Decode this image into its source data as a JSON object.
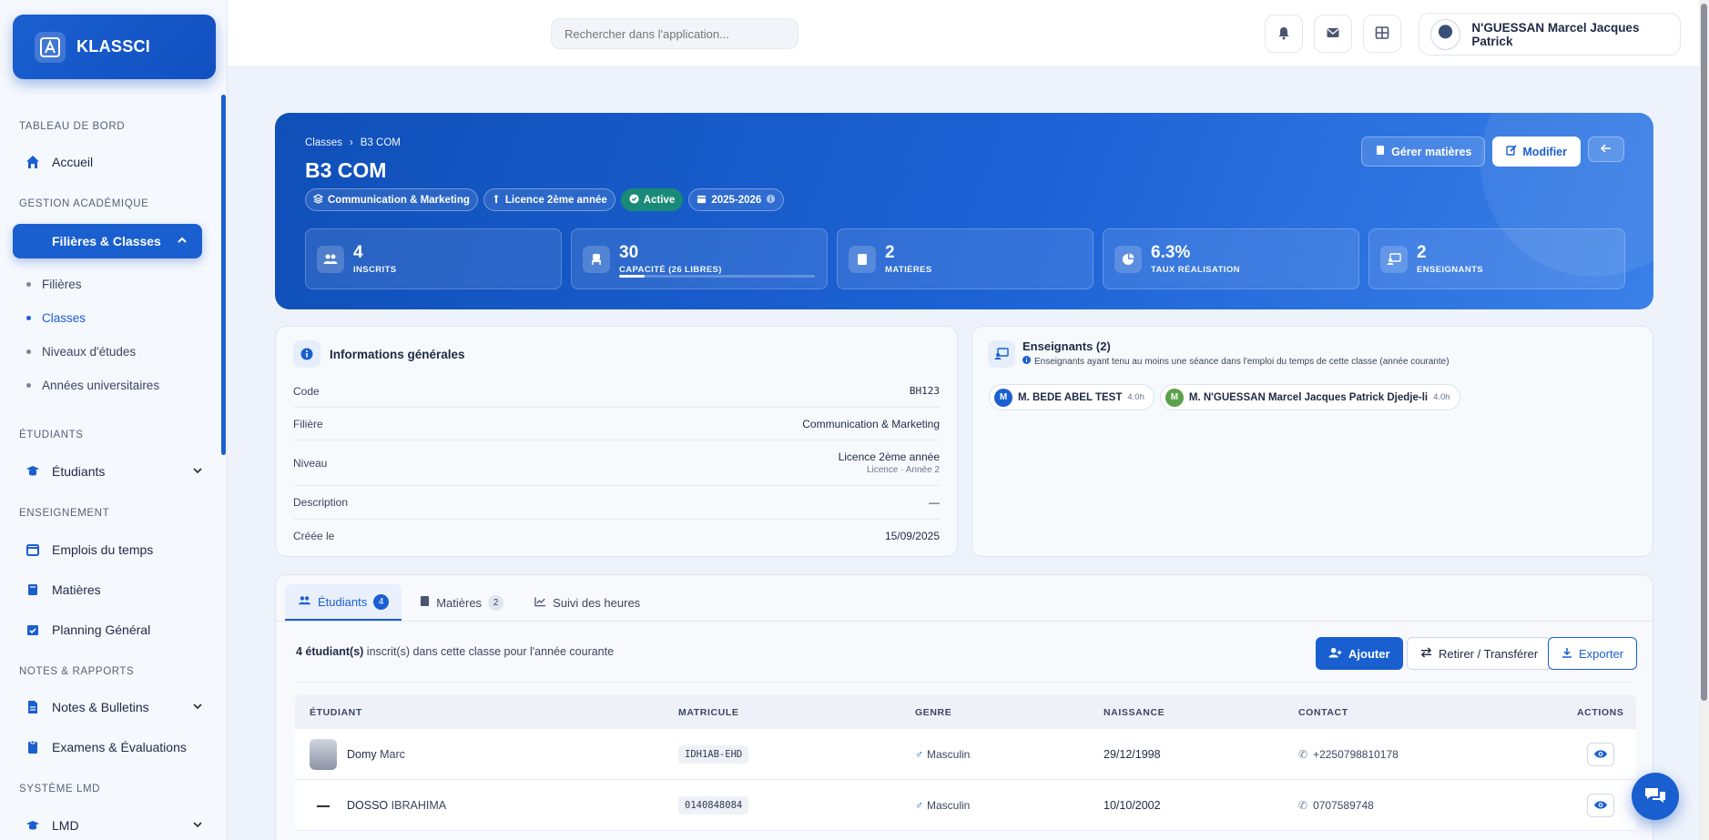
{
  "brand": {
    "name": "KLASSCI"
  },
  "search": {
    "placeholder": "Rechercher dans l'application..."
  },
  "user": {
    "name": "N'GUESSAN Marcel Jacques Patrick"
  },
  "sidebar": {
    "sections": {
      "dashboard": "TABLEAU DE BORD",
      "academic": "GESTION ACADÉMIQUE",
      "students": "ÉTUDIANTS",
      "teaching": "ENSEIGNEMENT",
      "notes": "NOTES & RAPPORTS",
      "lmd": "SYSTÈME LMD"
    },
    "items": {
      "home": "Accueil",
      "filieres_classes": "Filières & Classes",
      "sub_filieres": "Filières",
      "sub_classes": "Classes",
      "sub_niveaux": "Niveaux d'études",
      "sub_annees": "Années universitaires",
      "etudiants": "Étudiants",
      "emplois": "Emplois du temps",
      "matieres": "Matières",
      "planning": "Planning Général",
      "notes": "Notes & Bulletins",
      "examens": "Examens & Évaluations",
      "lmd": "LMD"
    }
  },
  "hero": {
    "breadcrumb": [
      "Classes",
      "B3 COM"
    ],
    "title": "B3 COM",
    "pills": {
      "filiere": "Communication & Marketing",
      "niveau": "Licence 2ème année",
      "status": "Active",
      "annee": "2025-2026"
    },
    "actions": {
      "matieres": "Gérer matières",
      "modifier": "Modifier"
    },
    "stats": [
      {
        "value": "4",
        "label": "INSCRITS"
      },
      {
        "value": "30",
        "label": "CAPACITÉ (26 LIBRES)",
        "progress": 0.13
      },
      {
        "value": "2",
        "label": "MATIÈRES"
      },
      {
        "value": "6.3%",
        "label": "TAUX RÉALISATION"
      },
      {
        "value": "2",
        "label": "ENSEIGNANTS"
      }
    ]
  },
  "info": {
    "title": "Informations générales",
    "rows": {
      "code_k": "Code",
      "code_v": "BH123",
      "filiere_k": "Filière",
      "filiere_v": "Communication & Marketing",
      "niveau_k": "Niveau",
      "niveau_v": "Licence 2ème année",
      "niveau_sub": "Licence · Année 2",
      "desc_k": "Description",
      "desc_v": "—",
      "cree_k": "Créée le",
      "cree_v": "15/09/2025"
    }
  },
  "teachers": {
    "title": "Enseignants (2)",
    "subtitle": "Enseignants ayant tenu au moins une séance dans l'emploi du temps de cette classe (année courante)",
    "list": [
      {
        "initial": "M",
        "name": "M. BEDE ABEL TEST",
        "hours": "4.0h",
        "color": "#1a5fd0"
      },
      {
        "initial": "M",
        "name": "M. N'GUESSAN Marcel Jacques Patrick Djedje-li",
        "hours": "4.0h",
        "color": "#5aa14a"
      }
    ]
  },
  "tabs": {
    "students": "Étudiants",
    "students_count": "4",
    "subjects": "Matières",
    "subjects_count": "2",
    "hours": "Suivi des heures"
  },
  "students": {
    "summary_bold": "4 étudiant(s)",
    "summary_rest": " inscrit(s) dans cette classe pour l'année courante",
    "add": "Ajouter",
    "transfer": "Retirer / Transférer",
    "export": "Exporter",
    "columns": [
      "ÉTUDIANT",
      "MATRICULE",
      "GENRE",
      "NAISSANCE",
      "CONTACT",
      "ACTIONS"
    ],
    "rows": [
      {
        "last": "Domy",
        "first": "Marc",
        "matricule": "IDH1AB-EHD",
        "genre": "Masculin",
        "naissance": "29/12/1998",
        "contact": "+2250798810178"
      },
      {
        "last": "DOSSO",
        "first": "IBRAHIMA",
        "matricule": "0140848084",
        "genre": "Masculin",
        "naissance": "10/10/2002",
        "contact": "0707589748"
      }
    ]
  }
}
